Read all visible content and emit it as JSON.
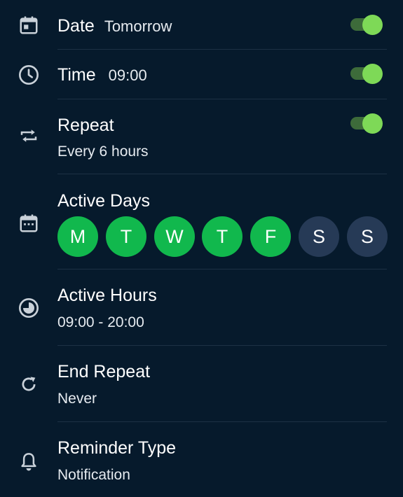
{
  "colors": {
    "background": "#061a2c",
    "toggle_on_thumb": "#7ed957",
    "toggle_on_track": "#3d6b3a",
    "day_active": "#11b84d",
    "day_inactive": "#263a56"
  },
  "settings": {
    "date": {
      "icon": "calendar-icon",
      "label": "Date",
      "value": "Tomorrow",
      "enabled": true
    },
    "time": {
      "icon": "clock-icon",
      "label": "Time",
      "value": "09:00",
      "enabled": true
    },
    "repeat": {
      "icon": "repeat-icon",
      "label": "Repeat",
      "value": "Every 6 hours",
      "enabled": true
    },
    "active_days": {
      "icon": "calendar-grid-icon",
      "label": "Active Days",
      "days": [
        {
          "letter": "M",
          "active": true
        },
        {
          "letter": "T",
          "active": true
        },
        {
          "letter": "W",
          "active": true
        },
        {
          "letter": "T",
          "active": true
        },
        {
          "letter": "F",
          "active": true
        },
        {
          "letter": "S",
          "active": false
        },
        {
          "letter": "S",
          "active": false
        }
      ]
    },
    "active_hours": {
      "icon": "clock-pie-icon",
      "label": "Active Hours",
      "value": "09:00 - 20:00"
    },
    "end_repeat": {
      "icon": "refresh-icon",
      "label": "End Repeat",
      "value": "Never"
    },
    "reminder_type": {
      "icon": "bell-icon",
      "label": "Reminder Type",
      "value": "Notification"
    }
  }
}
